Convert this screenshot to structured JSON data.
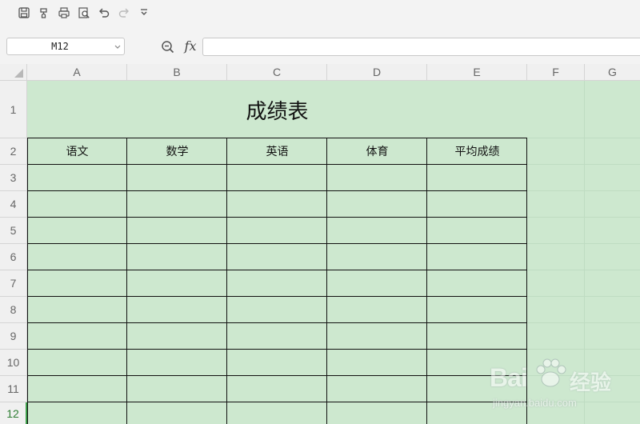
{
  "toolbar": {
    "icons": [
      "save-icon",
      "format-painter-icon",
      "print-icon",
      "print-preview-icon",
      "undo-icon",
      "redo-icon",
      "customize-icon"
    ]
  },
  "formula_bar": {
    "name_box": "M12",
    "fx_label": "fx",
    "formula": ""
  },
  "columns": [
    "A",
    "B",
    "C",
    "D",
    "E",
    "F",
    "G"
  ],
  "rows": [
    "1",
    "2",
    "3",
    "4",
    "5",
    "6",
    "7",
    "8",
    "9",
    "10",
    "11",
    "12"
  ],
  "active_row": "12",
  "sheet": {
    "title": "成绩表",
    "headers": [
      "语文",
      "数学",
      "英语",
      "体育",
      "平均成绩"
    ]
  },
  "colors": {
    "cell_fill": "#cde8cf",
    "header_bg": "#f0f0f0",
    "active_row_accent": "#3a9c47"
  },
  "watermark": {
    "brand": "Bai",
    "brand_suffix": "经验",
    "url": "jingyan.baidu.com"
  }
}
